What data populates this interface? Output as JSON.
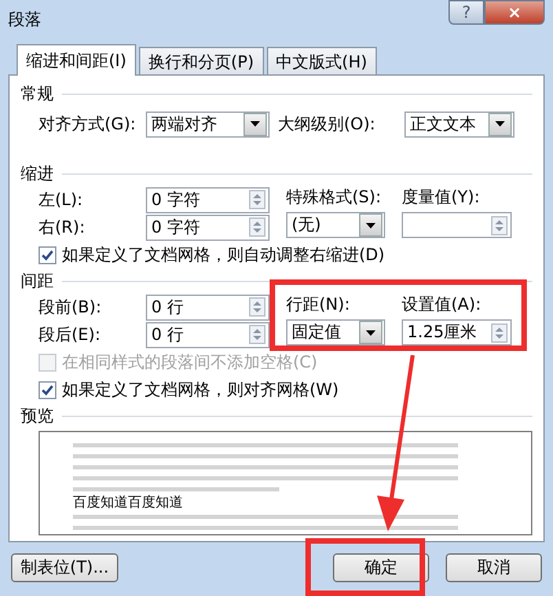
{
  "window": {
    "title": "段落",
    "help": "?",
    "close": "×"
  },
  "tabs": [
    {
      "label": "缩进和间距(I)",
      "selected": true
    },
    {
      "label": "换行和分页(P)",
      "selected": false
    },
    {
      "label": "中文版式(H)",
      "selected": false
    }
  ],
  "general": {
    "heading": "常规",
    "alignment": {
      "label": "对齐方式(G):",
      "value": "两端对齐"
    },
    "outline_level": {
      "label": "大纲级别(O):",
      "value": "正文文本"
    }
  },
  "indent": {
    "heading": "缩进",
    "left": {
      "label": "左(L):",
      "value": "0 字符"
    },
    "right": {
      "label": "右(R):",
      "value": "0 字符"
    },
    "special": {
      "label": "特殊格式(S):",
      "value": "(无)"
    },
    "by": {
      "label": "度量值(Y):"
    },
    "checkboxes": [
      {
        "label": "如果定义了文档网格，则自动调整右缩进(D)",
        "checked": true,
        "disabled": false
      }
    ]
  },
  "spacing": {
    "heading": "间距",
    "before": {
      "label": "段前(B):",
      "value": "0 行"
    },
    "after": {
      "label": "段后(E):",
      "value": "0 行"
    },
    "line_spacing": {
      "label": "行距(N):",
      "value": "固定值"
    },
    "at": {
      "label": "设置值(A):",
      "value": "1.25厘米"
    },
    "checkboxes": [
      {
        "label": "在相同样式的段落间不添加空格(C)",
        "checked": false,
        "disabled": true
      },
      {
        "label": "如果定义了文档网格，则对齐网格(W)",
        "checked": true,
        "disabled": false
      }
    ]
  },
  "preview": {
    "heading": "预览",
    "sample": "百度知道百度知道"
  },
  "buttons": [
    {
      "label": "制表位(T)...",
      "kind": "left"
    },
    {
      "label": "确定",
      "kind": "right"
    },
    {
      "label": "取消",
      "kind": "right"
    }
  ]
}
